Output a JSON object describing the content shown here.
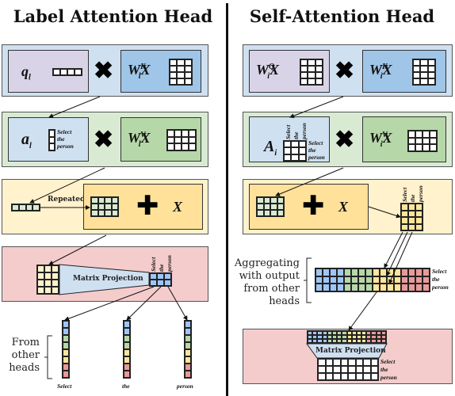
{
  "left": {
    "title": "Label Attention Head",
    "row1": {
      "left_label": "q",
      "left_sub": "l",
      "right_label": "W",
      "right_sup": "K",
      "right_sub": "l",
      "right_suffix": "X"
    },
    "row2": {
      "left_label": "a",
      "left_sub": "l",
      "tokens": [
        "Select",
        "the",
        "person"
      ],
      "right_label": "W",
      "right_sup": "V",
      "right_sub": "l",
      "right_suffix": "X"
    },
    "row3": {
      "repeated_label": "Repeated",
      "x_label": "X"
    },
    "row4": {
      "projection_label": "Matrix Projection",
      "tokens": [
        "Select",
        "the",
        "person"
      ]
    },
    "bottom": {
      "side_label": [
        "From",
        "other",
        "heads"
      ],
      "tokens": [
        "Select",
        "the",
        "person"
      ]
    }
  },
  "right": {
    "title": "Self-Attention Head",
    "row1": {
      "left_label": "W",
      "left_sup": "Q",
      "left_sub": "i",
      "left_suffix": "X",
      "right_label": "W",
      "right_sup": "K",
      "right_sub": "i",
      "right_suffix": "X"
    },
    "row2": {
      "left_label": "A",
      "left_sub": "i",
      "col_tokens": [
        "Select",
        "the",
        "person"
      ],
      "row_tokens": [
        "Select",
        "the",
        "person"
      ],
      "right_label": "W",
      "right_sup": "V",
      "right_sub": "i",
      "right_suffix": "X"
    },
    "row3": {
      "x_label": "X",
      "tokens": [
        "Select",
        "the",
        "person"
      ]
    },
    "aggregate": {
      "side_label": [
        "Aggregating",
        "with output",
        "from other",
        "heads"
      ],
      "tokens": [
        "Select",
        "the",
        "person"
      ]
    },
    "row4": {
      "projection_label": "Matrix Projection",
      "tokens": [
        "Select",
        "the",
        "person"
      ]
    }
  },
  "colors": {
    "blue_panel": "#cfe0f1",
    "purple_box": "#d9d3e8",
    "blue_box": "#9fc5e8",
    "green_panel": "#d9ead3",
    "green_box": "#b6d7a8",
    "yellow_panel": "#fff2cc",
    "yellow_box": "#ffe199",
    "red_panel": "#f4cccc",
    "cell_blue": "#9fc5f8",
    "cell_green": "#b6d7a8",
    "cell_yellow": "#ffe599",
    "cell_red": "#ea9999",
    "cell_light_green": "#d9ead3",
    "cell_cream": "#fff2cc"
  }
}
